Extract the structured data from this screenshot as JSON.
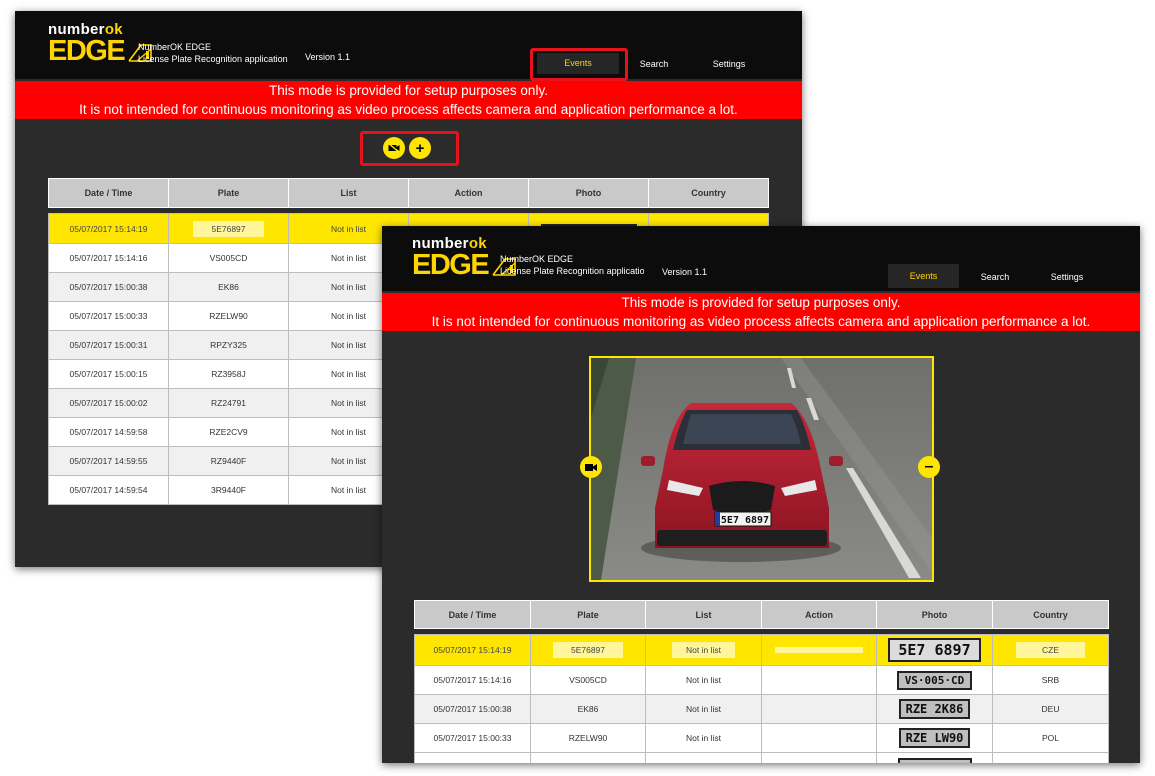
{
  "app": {
    "brand_top": "number",
    "brand_top_accent": "ok",
    "brand_main": "EDGE",
    "title_line1": "NumberOK EDGE",
    "title_line2": "License Plate Recognition application",
    "version": "Version 1.1"
  },
  "nav": {
    "events": "Events",
    "search": "Search",
    "settings": "Settings"
  },
  "banner": {
    "line1": "This mode is provided for setup purposes only.",
    "line2": "It is not intended for continuous monitoring as video process affects camera and application performance a lot."
  },
  "table": {
    "headers": [
      "Date / Time",
      "Plate",
      "List",
      "Action",
      "Photo",
      "Country"
    ]
  },
  "window1": {
    "rows": [
      {
        "datetime": "05/07/2017 15:14:19",
        "plate": "5E76897",
        "list": "Not in list"
      },
      {
        "datetime": "05/07/2017 15:14:16",
        "plate": "VS005CD",
        "list": "Not in list"
      },
      {
        "datetime": "05/07/2017 15:00:38",
        "plate": "EK86",
        "list": "Not in list"
      },
      {
        "datetime": "05/07/2017 15:00:33",
        "plate": "RZELW90",
        "list": "Not in list"
      },
      {
        "datetime": "05/07/2017 15:00:31",
        "plate": "RPZY325",
        "list": "Not in list"
      },
      {
        "datetime": "05/07/2017 15:00:15",
        "plate": "RZ3958J",
        "list": "Not in list"
      },
      {
        "datetime": "05/07/2017 15:00:02",
        "plate": "RZ24791",
        "list": "Not in list"
      },
      {
        "datetime": "05/07/2017 14:59:58",
        "plate": "RZE2CV9",
        "list": "Not in list"
      },
      {
        "datetime": "05/07/2017 14:59:55",
        "plate": "RZ9440F",
        "list": "Not in list"
      },
      {
        "datetime": "05/07/2017 14:59:54",
        "plate": "3R9440F",
        "list": "Not in list"
      }
    ]
  },
  "window2": {
    "camera_plate": "5E7 6897",
    "rows": [
      {
        "datetime": "05/07/2017 15:14:19",
        "plate": "5E76897",
        "list": "Not in list",
        "photo": "5E7 6897",
        "country": "CZE"
      },
      {
        "datetime": "05/07/2017 15:14:16",
        "plate": "VS005CD",
        "list": "Not in list",
        "photo": "VS·005·CD",
        "country": "SRB"
      },
      {
        "datetime": "05/07/2017 15:00:38",
        "plate": "EK86",
        "list": "Not in list",
        "photo": "RZE 2K86",
        "country": "DEU"
      },
      {
        "datetime": "05/07/2017 15:00:33",
        "plate": "RZELW90",
        "list": "Not in list",
        "photo": "RZE LW90",
        "country": "POL"
      }
    ]
  },
  "colors": {
    "accent": "#ffe600",
    "banner": "#ff0000",
    "header": "#0c0c0c",
    "background": "#2b2b2b",
    "highlight_box": "#e8121c"
  }
}
